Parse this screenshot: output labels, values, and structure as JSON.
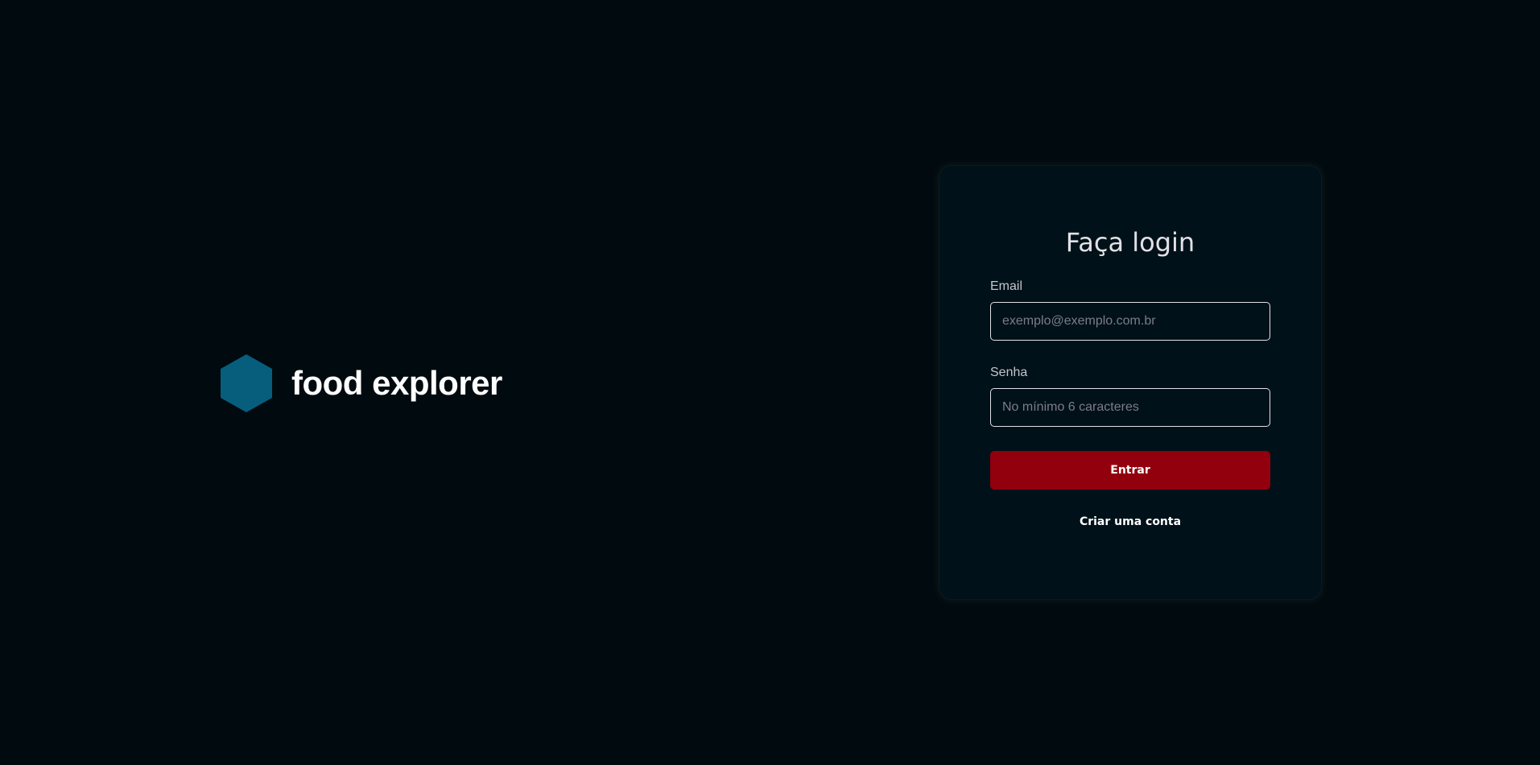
{
  "brand": {
    "name": "food explorer",
    "icon": "hexagon-icon",
    "icon_color": "#065e7c"
  },
  "login": {
    "title": "Faça login",
    "email": {
      "label": "Email",
      "value": "",
      "placeholder": "exemplo@exemplo.com.br"
    },
    "password": {
      "label": "Senha",
      "value": "",
      "placeholder": "No mínimo 6 caracteres"
    },
    "submit_label": "Entrar",
    "signup_label": "Criar uma conta"
  },
  "colors": {
    "background": "#000a0f",
    "card": "#001119",
    "primary_button": "#92000e",
    "text": "#e1e1e6",
    "placeholder": "#7c7c8a"
  }
}
